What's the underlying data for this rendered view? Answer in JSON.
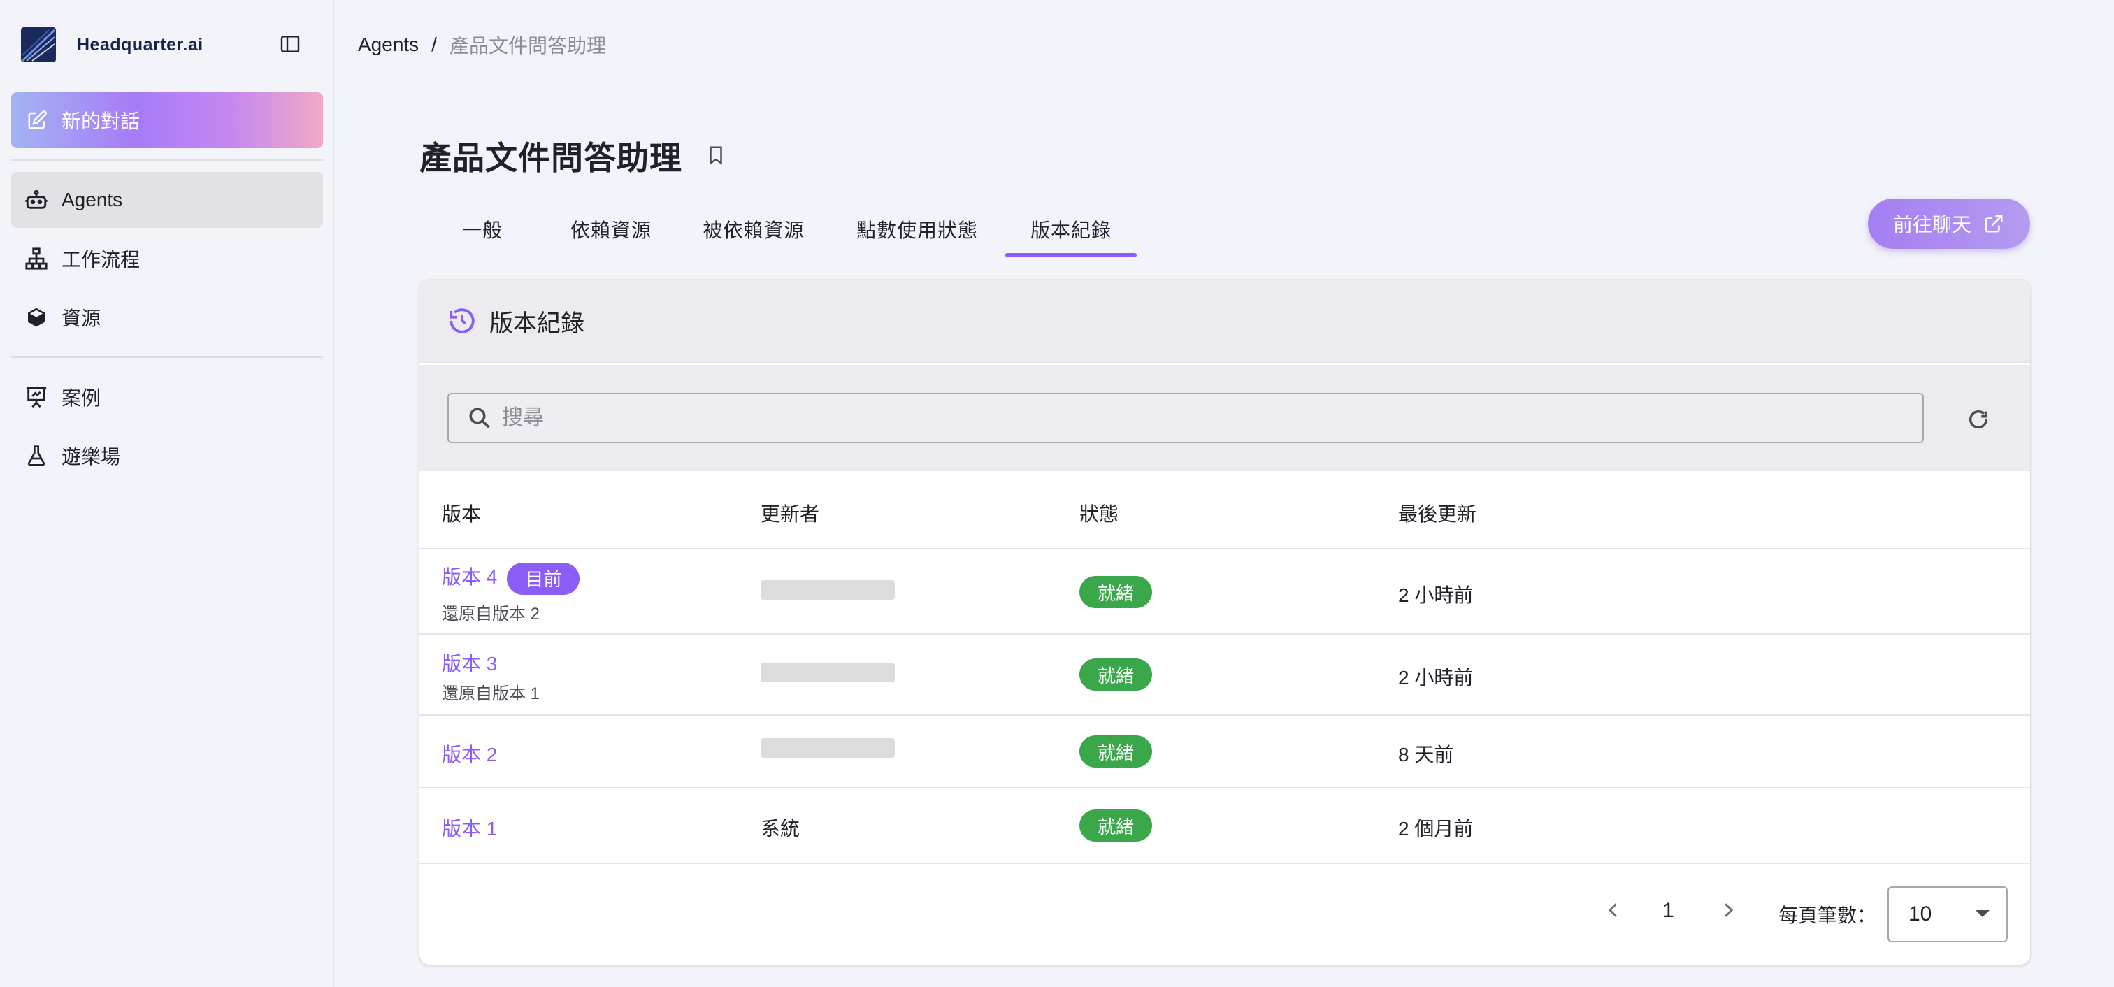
{
  "brand": {
    "name": "Headquarter.ai"
  },
  "sidebar": {
    "new_chat_label": "新的對話",
    "items": [
      {
        "label": "Agents",
        "icon": "robot-icon",
        "active": true
      },
      {
        "label": "工作流程",
        "icon": "workflow-icon"
      },
      {
        "label": "資源",
        "icon": "cube-icon"
      },
      {
        "label": "案例",
        "icon": "presentation-icon"
      },
      {
        "label": "遊樂場",
        "icon": "flask-icon"
      }
    ]
  },
  "breadcrumb": {
    "root": "Agents",
    "separator": "/",
    "current": "產品文件問答助理"
  },
  "page": {
    "title": "產品文件問答助理"
  },
  "tabs": [
    {
      "label": "一般"
    },
    {
      "label": "依賴資源"
    },
    {
      "label": "被依賴資源"
    },
    {
      "label": "點數使用狀態"
    },
    {
      "label": "版本紀錄",
      "active": true
    }
  ],
  "goto_chat_label": "前往聊天",
  "card": {
    "title": "版本紀錄",
    "search_placeholder": "搜尋",
    "columns": {
      "version": "版本",
      "updater": "更新者",
      "status": "狀態",
      "updated": "最後更新"
    },
    "rows": [
      {
        "version": "版本 4",
        "badge": "目前",
        "sub": "還原自版本 2",
        "updater": "",
        "status": "就緒",
        "updated": "2 小時前"
      },
      {
        "version": "版本 3",
        "sub": "還原自版本 1",
        "updater": "",
        "status": "就緒",
        "updated": "2 小時前"
      },
      {
        "version": "版本 2",
        "updater": "",
        "status": "就緒",
        "updated": "8 天前"
      },
      {
        "version": "版本 1",
        "updater": "系統",
        "status": "就緒",
        "updated": "2 個月前"
      }
    ],
    "pagination": {
      "page": "1",
      "per_page_label": "每頁筆數：",
      "per_page_value": "10"
    }
  },
  "colors": {
    "accent": "#8b5cf6",
    "status_ready": "#3aa84a"
  }
}
